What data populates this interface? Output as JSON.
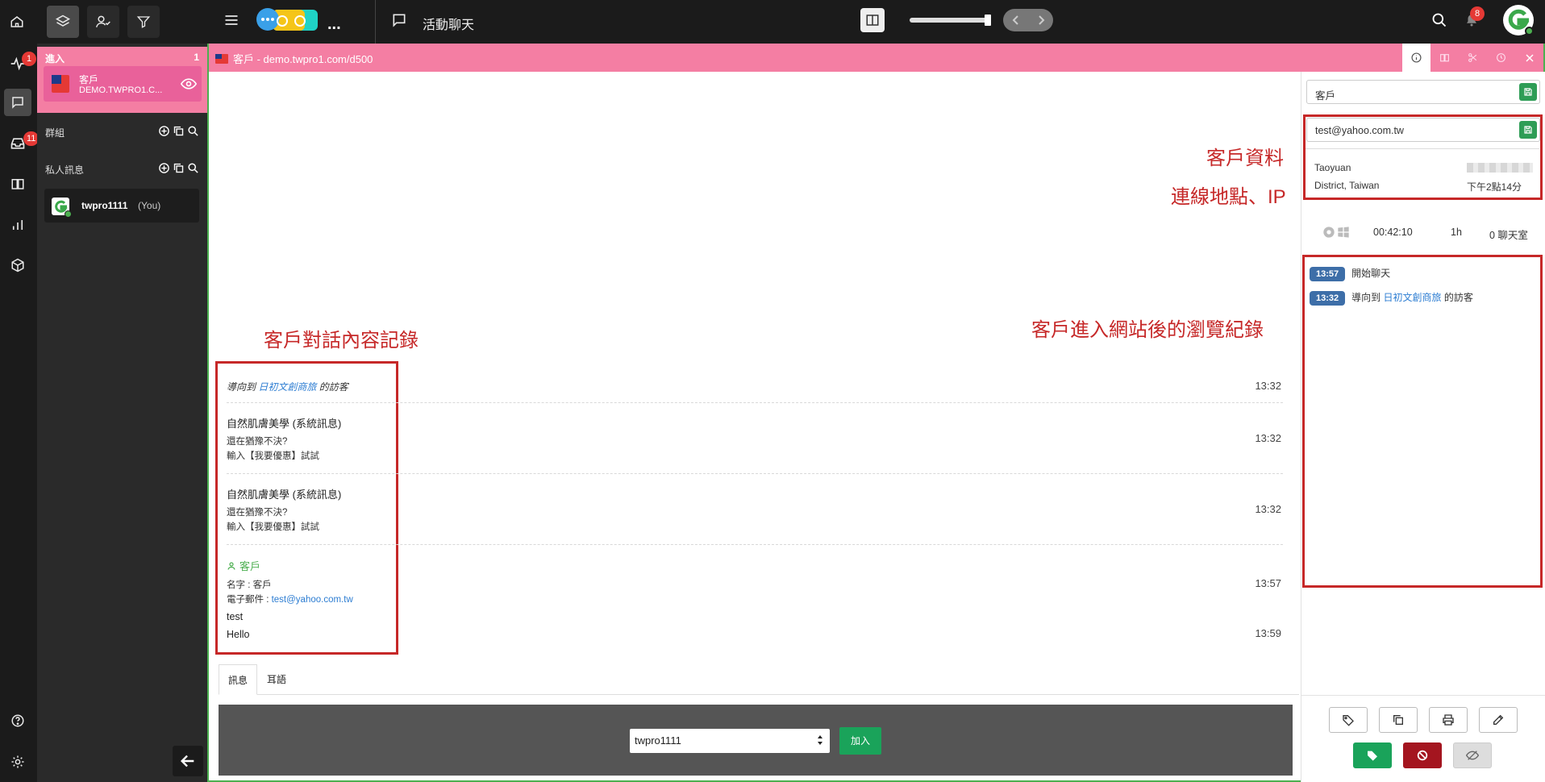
{
  "topbar": {
    "menu_dots": "...",
    "title": "活動聊天",
    "notification_count": "8"
  },
  "rail": {
    "activity_badge": "1",
    "inbox_badge": "11"
  },
  "sidepanel": {
    "incoming_label": "進入",
    "incoming_count": "1",
    "visitor_name": "客戶",
    "visitor_site": "DEMO.TWPRO1.C...",
    "groups_label": "群組",
    "private_label": "私人訊息",
    "user_name": "twpro1111",
    "user_you": "(You)"
  },
  "chat": {
    "tab_title": "客戶 - demo.twpro1.com/d500",
    "annotation_record": "客戶對話內容記錄",
    "annotation_browse": "客戶進入網站後的瀏覽紀錄",
    "annotation_info": "客戶資料",
    "annotation_location": "連線地點、IP",
    "msg1_pre": "導向到",
    "msg1_link": "日初文創商旅",
    "msg1_post": "的訪客",
    "msg1_time": "13:32",
    "msg2_title": "自然肌膚美學 (系統訊息)",
    "msg2_line1": "還在猶豫不決?",
    "msg2_line2": "輸入【我要優惠】試試",
    "msg2_time": "13:32",
    "msg3_title": "自然肌膚美學 (系統訊息)",
    "msg3_line1": "還在猶豫不決?",
    "msg3_line2": "輸入【我要優惠】試試",
    "msg3_time": "13:32",
    "msg4_user": "客戶",
    "msg4_name_label": "名字 : 客戶",
    "msg4_email_label": "電子郵件 : ",
    "msg4_email": "test@yahoo.com.tw",
    "msg4_time": "13:57",
    "msg5_line1": "test",
    "msg5_line2": "Hello",
    "msg5_time": "13:59",
    "tab_message": "訊息",
    "tab_whisper": "耳語",
    "operator_select": "twpro1111",
    "join_button": "加入"
  },
  "info": {
    "name_value": "客戶",
    "email_value": "test@yahoo.com.tw",
    "city": "Taoyuan",
    "district": "District, Taiwan",
    "local_time": "下午2點14分",
    "duration": "00:42:10",
    "since": "1h",
    "rooms": "0 聊天室",
    "timeline": [
      {
        "time": "13:57",
        "text": "開始聊天"
      },
      {
        "time": "13:32",
        "pre": "導向到",
        "link": "日初文創商旅",
        "post": "的訪客"
      }
    ]
  },
  "colors": {
    "tab_pink": "#f47ea3",
    "annotation_red": "#c62828",
    "accent_green": "#2e9d56",
    "badge_blue": "#3d6ea8"
  }
}
